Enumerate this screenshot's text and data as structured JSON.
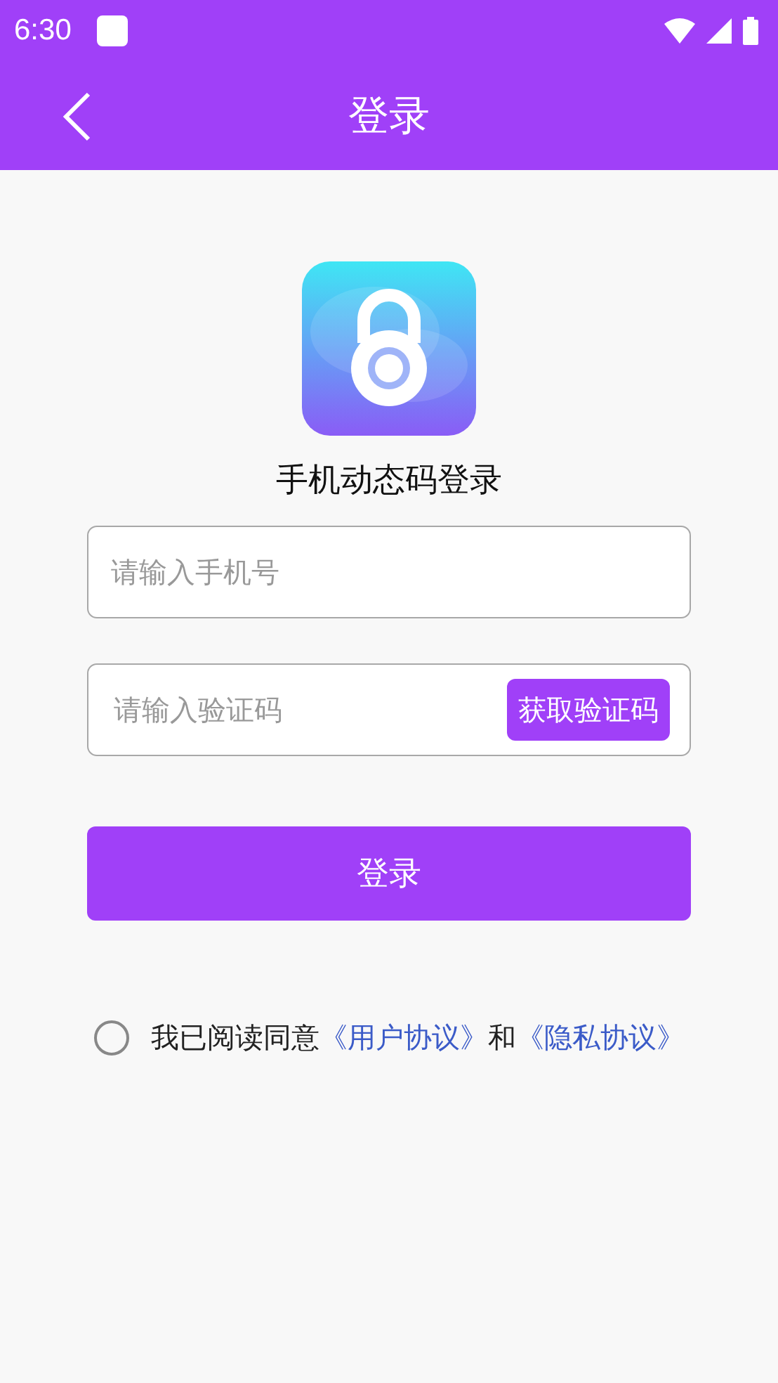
{
  "status_bar": {
    "time": "6:30"
  },
  "app_bar": {
    "title": "登录"
  },
  "heading": "手机动态码登录",
  "phone_field": {
    "placeholder": "请输入手机号"
  },
  "code_field": {
    "placeholder": "请输入验证码",
    "button": "获取验证码"
  },
  "login_button": "登录",
  "agreement": {
    "checked": false,
    "text": "我已阅读同意",
    "link_1": "《用户协议》",
    "joiner": "和",
    "link_2": "《隐私协议》"
  }
}
